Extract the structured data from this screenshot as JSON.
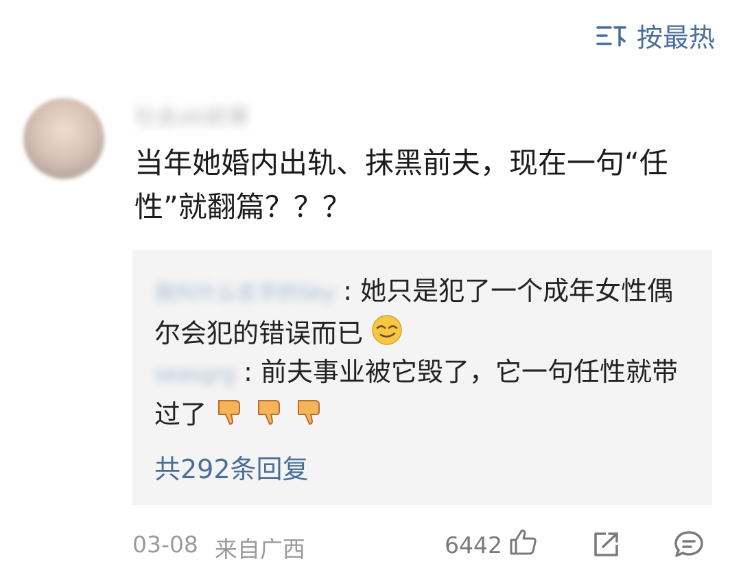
{
  "sort": {
    "label": "按最热",
    "icon": "sort-icon"
  },
  "comment": {
    "author_blurred": "社会ab前辈",
    "text": "当年她婚内出轨、抹黑前夫，现在一句“任性”就翻篇？？？"
  },
  "replies": [
    {
      "author_blurred": "我叫什么名字的Sky",
      "sep": ":",
      "text": "她只是犯了一个成年女性偶尔会犯的错误而已",
      "emoji": "smirk-face-emoji"
    },
    {
      "author_blurred": "seasgrg",
      "sep": ":",
      "text": "前夫事业被它毁了，它一句任性就带过了",
      "emoji": "thumbs-down-emoji"
    }
  ],
  "reply_count": "共292条回复",
  "footer": {
    "date": "03-08",
    "location": "来自广西",
    "likes": "6442"
  },
  "colors": {
    "accent": "#4a6e98",
    "muted": "#9b9b9b",
    "reply_bg": "#f4f4f4"
  }
}
